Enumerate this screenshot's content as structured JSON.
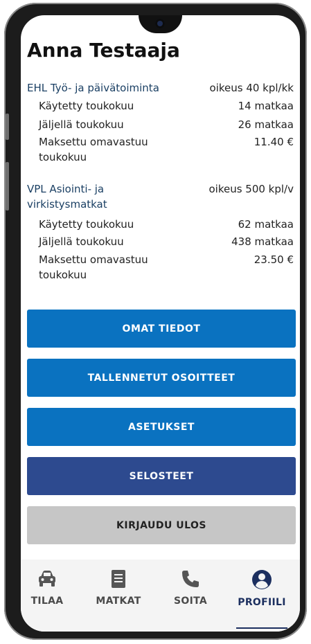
{
  "user": {
    "name": "Anna Testaaja"
  },
  "sections": [
    {
      "title": "EHL Työ- ja päivätoiminta",
      "right": "oikeus 40 kpl/kk",
      "rows": [
        {
          "label": "Käytetty toukokuu",
          "value": "14 matkaa"
        },
        {
          "label": "Jäljellä toukokuu",
          "value": "26 matkaa"
        },
        {
          "label": "Maksettu omavastuu toukokuu",
          "value": "11.40 €"
        }
      ]
    },
    {
      "title": "VPL Asiointi- ja virkistysmatkat",
      "right": "oikeus 500 kpl/v",
      "rows": [
        {
          "label": "Käytetty toukokuu",
          "value": "62 matkaa"
        },
        {
          "label": "Jäljellä toukokuu",
          "value": "438 matkaa"
        },
        {
          "label": "Maksettu omavastuu toukokuu",
          "value": "23.50 €"
        }
      ]
    }
  ],
  "buttons": {
    "omat_tiedot": "OMAT TIEDOT",
    "tallennetut": "TALLENNETUT OSOITTEET",
    "asetukset": "ASETUKSET",
    "selosteet": "SELOSTEET",
    "kirjaudu": "KIRJAUDU ULOS"
  },
  "nav": {
    "tilaa": {
      "label": "TILAA",
      "icon": "car-icon"
    },
    "matkat": {
      "label": "MATKAT",
      "icon": "receipt-icon"
    },
    "soita": {
      "label": "SOITA",
      "icon": "phone-icon"
    },
    "profiili": {
      "label": "PROFIILI",
      "icon": "user-circle-icon",
      "active": true
    }
  },
  "colors": {
    "button_blue": "#0a72c0",
    "button_dark": "#2d4a8f",
    "button_gray": "#c6c6c6",
    "nav_active": "#1c2f5f"
  }
}
